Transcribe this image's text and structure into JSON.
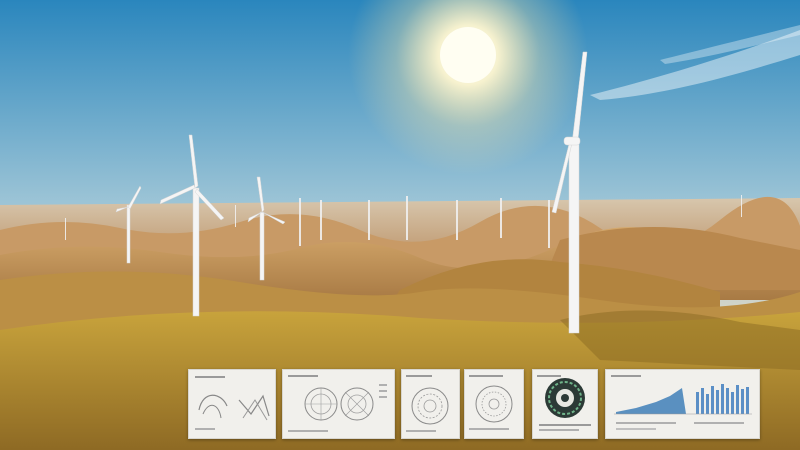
{
  "scene": {
    "description_icon": "wind-farm-photo",
    "colors": {
      "sky_top": "#2f8fc4",
      "sky_horizon": "#e9d9c0",
      "sun": "#fff8dc",
      "hills_near": "#b89a3a",
      "hills_far": "#c7a27a",
      "turbine": "#f2f2f2"
    }
  },
  "cards": [
    {
      "icon": "sketch-diagram-icon"
    },
    {
      "icon": "circular-diagram-pair-icon"
    },
    {
      "icon": "radial-diagram-icon"
    },
    {
      "icon": "radial-diagram-icon"
    },
    {
      "icon": "ring-diagram-icon"
    },
    {
      "icon": "bar-chart-icon"
    }
  ]
}
